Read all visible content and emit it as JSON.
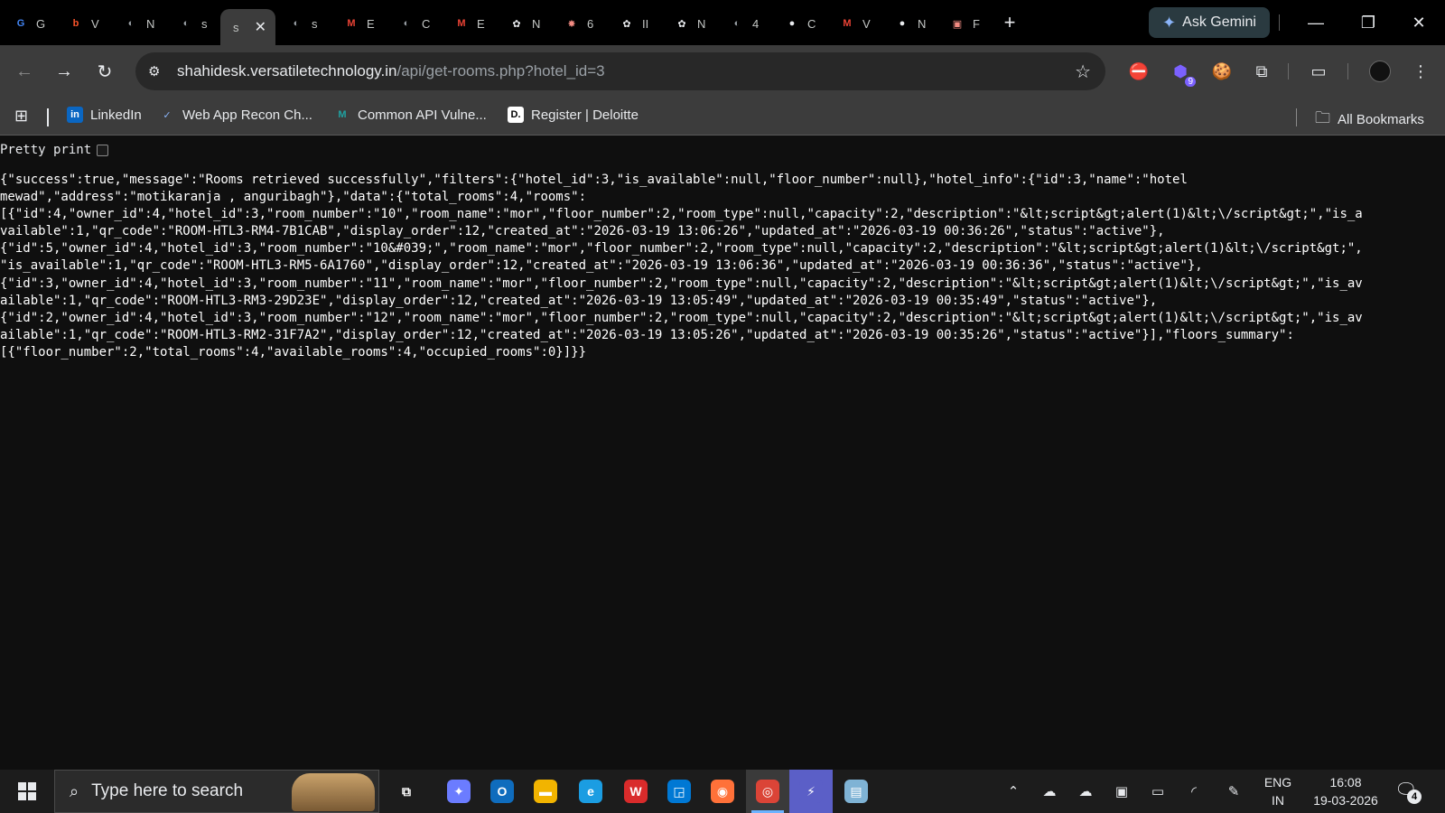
{
  "browser": {
    "tabs": [
      {
        "icon": "google-icon",
        "title": "G",
        "color": "#4285f4",
        "glyph": "G"
      },
      {
        "icon": "brave-icon",
        "title": "V",
        "color": "#fb542b",
        "glyph": "b"
      },
      {
        "icon": "globe-icon",
        "title": "N",
        "color": "#9aa0a6",
        "glyph": "◐"
      },
      {
        "icon": "globe-icon",
        "title": "s",
        "color": "#9aa0a6",
        "glyph": "◐"
      },
      {
        "icon": "",
        "title": "s",
        "color": "",
        "glyph": ""
      },
      {
        "icon": "globe-icon",
        "title": "s",
        "color": "#9aa0a6",
        "glyph": "◐"
      },
      {
        "icon": "gmail-icon",
        "title": "E",
        "color": "#ea4335",
        "glyph": "M"
      },
      {
        "icon": "globe-icon",
        "title": "C",
        "color": "#9aa0a6",
        "glyph": "◐"
      },
      {
        "icon": "gmail-icon",
        "title": "E",
        "color": "#ea4335",
        "glyph": "M"
      },
      {
        "icon": "openai-icon",
        "title": "N",
        "color": "#e8eaed",
        "glyph": "✿"
      },
      {
        "icon": "bug-icon",
        "title": "6",
        "color": "#f28b82",
        "glyph": "✸"
      },
      {
        "icon": "openai-icon",
        "title": "II",
        "color": "#e8eaed",
        "glyph": "✿"
      },
      {
        "icon": "openai-icon",
        "title": "N",
        "color": "#e8eaed",
        "glyph": "✿"
      },
      {
        "icon": "globe-icon",
        "title": "4",
        "color": "#9aa0a6",
        "glyph": "◐"
      },
      {
        "icon": "github-icon",
        "title": "C",
        "color": "#e8eaed",
        "glyph": "●"
      },
      {
        "icon": "gmail-icon",
        "title": "V",
        "color": "#ea4335",
        "glyph": "M"
      },
      {
        "icon": "github-icon",
        "title": "N",
        "color": "#e8eaed",
        "glyph": "●"
      },
      {
        "icon": "page-icon",
        "title": "F",
        "color": "#f28b82",
        "glyph": "▣"
      }
    ],
    "active_tab_title": "s",
    "ask_gemini_label": "Ask Gemini",
    "url_host": "shahidesk.versatiletechnology.in",
    "url_path": "/api/get-rooms.php?hotel_id=3",
    "extensions": [
      {
        "name": "extension-blocker-icon",
        "glyph": "⛔",
        "color": "#f28b82"
      },
      {
        "name": "extension-badge-icon",
        "glyph": "⬢",
        "color": "#7b61ff",
        "badge": "9"
      },
      {
        "name": "cookie-icon",
        "glyph": "🍪",
        "color": "#d2a679"
      },
      {
        "name": "puzzle-icon",
        "glyph": "⧉",
        "color": "#e8eaed"
      }
    ],
    "bookmarks": [
      {
        "label": "LinkedIn",
        "icon": "linkedin-icon",
        "glyph": "in",
        "color": "#0a66c2"
      },
      {
        "label": "Web App Recon Ch...",
        "icon": "bookmark-site-icon",
        "glyph": "✓",
        "color": "#8ab4f8"
      },
      {
        "label": "Common API Vulne...",
        "icon": "bookmark-site-icon",
        "glyph": "M",
        "color": "#1fa2a2"
      },
      {
        "label": "Register | Deloitte",
        "icon": "deloitte-icon",
        "glyph": "D.",
        "color": "#ffffff"
      }
    ],
    "all_bookmarks_label": "All Bookmarks"
  },
  "page": {
    "pretty_print_label": "Pretty print",
    "pretty_print_checked": false,
    "json_lines": [
      "{\"success\":true,\"message\":\"Rooms retrieved successfully\",\"filters\":{\"hotel_id\":3,\"is_available\":null,\"floor_number\":null},\"hotel_info\":{\"id\":3,\"name\":\"hotel",
      "mewad\",\"address\":\"motikaranja , anguribagh\"},\"data\":{\"total_rooms\":4,\"rooms\":",
      "[{\"id\":4,\"owner_id\":4,\"hotel_id\":3,\"room_number\":\"10\",\"room_name\":\"mor\",\"floor_number\":2,\"room_type\":null,\"capacity\":2,\"description\":\"&lt;script&gt;alert(1)&lt;\\/script&gt;\",\"is_a",
      "vailable\":1,\"qr_code\":\"ROOM-HTL3-RM4-7B1CAB\",\"display_order\":12,\"created_at\":\"2026-03-19 13:06:26\",\"updated_at\":\"2026-03-19 00:36:26\",\"status\":\"active\"},",
      "{\"id\":5,\"owner_id\":4,\"hotel_id\":3,\"room_number\":\"10&#039;\",\"room_name\":\"mor\",\"floor_number\":2,\"room_type\":null,\"capacity\":2,\"description\":\"&lt;script&gt;alert(1)&lt;\\/script&gt;\",",
      "\"is_available\":1,\"qr_code\":\"ROOM-HTL3-RM5-6A1760\",\"display_order\":12,\"created_at\":\"2026-03-19 13:06:36\",\"updated_at\":\"2026-03-19 00:36:36\",\"status\":\"active\"},",
      "{\"id\":3,\"owner_id\":4,\"hotel_id\":3,\"room_number\":\"11\",\"room_name\":\"mor\",\"floor_number\":2,\"room_type\":null,\"capacity\":2,\"description\":\"&lt;script&gt;alert(1)&lt;\\/script&gt;\",\"is_av",
      "ailable\":1,\"qr_code\":\"ROOM-HTL3-RM3-29D23E\",\"display_order\":12,\"created_at\":\"2026-03-19 13:05:49\",\"updated_at\":\"2026-03-19 00:35:49\",\"status\":\"active\"},",
      "{\"id\":2,\"owner_id\":4,\"hotel_id\":3,\"room_number\":\"12\",\"room_name\":\"mor\",\"floor_number\":2,\"room_type\":null,\"capacity\":2,\"description\":\"&lt;script&gt;alert(1)&lt;\\/script&gt;\",\"is_av",
      "ailable\":1,\"qr_code\":\"ROOM-HTL3-RM2-31F7A2\",\"display_order\":12,\"created_at\":\"2026-03-19 13:05:26\",\"updated_at\":\"2026-03-19 00:35:26\",\"status\":\"active\"}],\"floors_summary\":",
      "[{\"floor_number\":2,\"total_rooms\":4,\"available_rooms\":4,\"occupied_rooms\":0}]}}"
    ]
  },
  "taskbar": {
    "search_placeholder": "Type here to search",
    "apps": [
      {
        "name": "task-view-icon",
        "glyph": "⧉",
        "color": "#3a3a3a"
      },
      {
        "name": "copilot-icon",
        "glyph": "✦",
        "color": "#6b7cff"
      },
      {
        "name": "outlook-icon",
        "glyph": "O",
        "color": "#0f6cbd"
      },
      {
        "name": "file-explorer-icon",
        "glyph": "▬",
        "color": "#f2b400"
      },
      {
        "name": "edge-icon",
        "glyph": "e",
        "color": "#1b9de2"
      },
      {
        "name": "wps-icon",
        "glyph": "W",
        "color": "#d92b2b"
      },
      {
        "name": "snip-icon",
        "glyph": "◲",
        "color": "#0078d4"
      },
      {
        "name": "firefox-icon",
        "glyph": "◉",
        "color": "#ff7139"
      },
      {
        "name": "chrome-icon",
        "glyph": "◎",
        "color": "#db4437"
      },
      {
        "name": "power-automate-icon",
        "glyph": "⚡",
        "color": "#5b5fc7"
      },
      {
        "name": "notes-icon",
        "glyph": "▤",
        "color": "#7fb3d5"
      }
    ],
    "lang_top": "ENG",
    "lang_bottom": "IN",
    "time": "16:08",
    "date": "19-03-2026",
    "notification_count": "4"
  }
}
